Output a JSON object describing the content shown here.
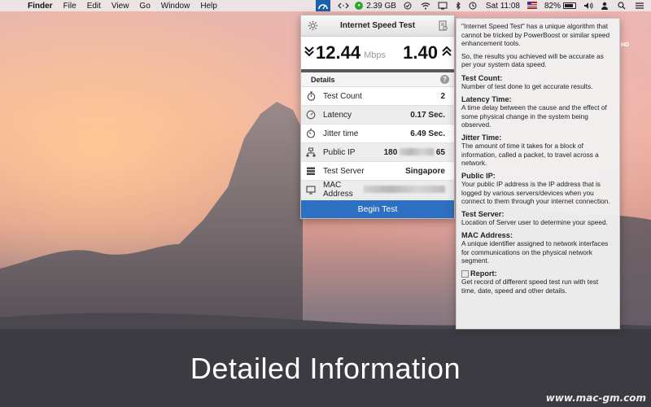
{
  "menubar": {
    "apple_glyph": "",
    "items": [
      "Finder",
      "File",
      "Edit",
      "View",
      "Go",
      "Window",
      "Help"
    ],
    "memory": "2.39 GB",
    "battery_percent": "82%",
    "battery_level": 0.82,
    "clock": "Sat 11:08"
  },
  "popup": {
    "title": "Internet Speed Test",
    "download_value": "12.44",
    "unit": "Mbps",
    "upload_value": "1.40",
    "details_label": "Details",
    "help_glyph": "?",
    "rows": [
      {
        "label": "Test Count",
        "value": "2"
      },
      {
        "label": "Latency",
        "value": "0.17 Sec."
      },
      {
        "label": "Jitter time",
        "value": "6.49 Sec."
      },
      {
        "label": "Public IP",
        "value_prefix": "180",
        "value_suffix": "65"
      },
      {
        "label": "Test Server",
        "value": "Singapore"
      },
      {
        "label": "MAC Address",
        "value": ""
      }
    ],
    "begin_button": "Begin Test"
  },
  "help": {
    "intro1": "\"Internet Speed Test\" has a unique algorithm that cannot be tricked by PowerBoost or similar speed enhancement tools.",
    "intro2": "So, the results you achieved will be accurate as per your system data speed.",
    "sections": [
      {
        "title": "Test Count:",
        "body": "Number of test done to get accurate results."
      },
      {
        "title": "Latency Time:",
        "body": "A time delay between the cause and the effect of some physical change in the system being observed."
      },
      {
        "title": "Jitter Time:",
        "body": "The amount of time it takes for a block of information, called a packet, to travel across a network."
      },
      {
        "title": "Public IP:",
        "body": "Your public IP address is the IP address that is logged by various servers/devices when you connect to them through your internet connection."
      },
      {
        "title": "Test Server:",
        "body": "Location of Server user to determine your speed."
      },
      {
        "title": "MAC Address:",
        "body": "A unique identifier assigned to network interfaces for communications on the physical network segment."
      },
      {
        "title": "Report:",
        "body": "Get record of different speed test run with test time, date, speed and other details."
      }
    ]
  },
  "hd_tag": "HD",
  "caption": "Detailed Information",
  "watermark": "www.mac-gm.com",
  "colors": {
    "accent": "#2d6fc0",
    "divider": "#5a5a5a"
  }
}
